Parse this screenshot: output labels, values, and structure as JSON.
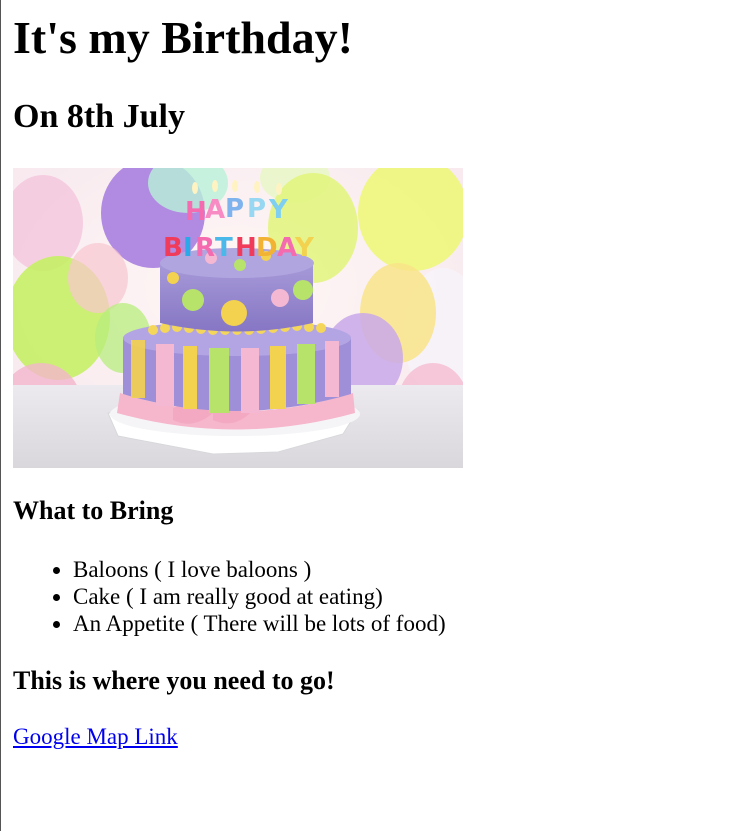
{
  "heading": "It's my Birthday!",
  "subheading": "On 8th July",
  "image": {
    "candle_letters": [
      "H",
      "A",
      "P",
      "P",
      "Y",
      "B",
      "I",
      "R",
      "T",
      "H",
      "D",
      "A",
      "Y"
    ]
  },
  "bring": {
    "title": "What to Bring",
    "items": [
      "Baloons ( I love baloons )",
      "Cake ( I am really good at eating)",
      "An Appetite ( There will be lots of food)"
    ]
  },
  "directions": {
    "title": "This is where you need to go!",
    "link_label": "Google Map Link"
  }
}
